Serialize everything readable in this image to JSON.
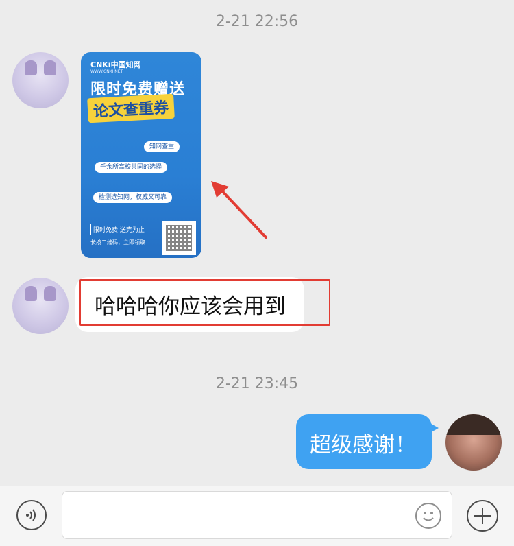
{
  "conversation": {
    "timestamps": [
      "2-21 22:56",
      "2-21 23:45"
    ],
    "messages": [
      {
        "side": "left",
        "type": "image",
        "poster": {
          "brand": "CNKi中国知网",
          "brand_sub": "WWW.CNKI.NET",
          "headline": "限时免费赠送",
          "tag": "论文查重券",
          "bubble_1": "知网查重",
          "bubble_2": "千余所高校共同的选择",
          "bubble_3": "检测选知网，权威又可靠",
          "badge": "限时免费 送完为止",
          "badge_sub": "长按二维码，立即领取"
        }
      },
      {
        "side": "left",
        "type": "text",
        "text": "哈哈哈你应该会用到"
      },
      {
        "side": "right",
        "type": "text",
        "text": "超级感谢！"
      }
    ]
  },
  "input_bar": {
    "voice_icon": "voice-icon",
    "emoji_icon": "emoji-icon",
    "plus_icon": "plus-icon"
  },
  "colors": {
    "background": "#ececec",
    "outgoing_bubble": "#3fa2f2",
    "annotation_red": "#e23c33"
  }
}
